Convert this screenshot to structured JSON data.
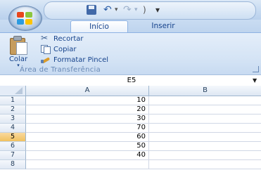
{
  "tabs": [
    {
      "label": "Início",
      "active": true
    },
    {
      "label": "Inserir",
      "active": false
    }
  ],
  "quick_access": {
    "icons": [
      "save-icon",
      "undo-icon",
      "redo-icon"
    ]
  },
  "ribbon": {
    "paste_label": "Colar",
    "paste_arrow": "▾",
    "cut_label": "Recortar",
    "copy_label": "Copiar",
    "format_painter_label": "Formatar Pincel",
    "group_label": "Área de Transferência"
  },
  "name_box": {
    "value": "E5",
    "dropdown": "▼"
  },
  "grid": {
    "columns": [
      "A",
      "B"
    ],
    "rows": [
      "1",
      "2",
      "3",
      "4",
      "5",
      "6",
      "7",
      "8"
    ],
    "active_row": "5",
    "column_a_values": [
      "10",
      "20",
      "30",
      "70",
      "60",
      "50",
      "40",
      ""
    ]
  },
  "colors": {
    "ribbon_text": "#15428b",
    "active_row_header": "#f1c15f"
  }
}
